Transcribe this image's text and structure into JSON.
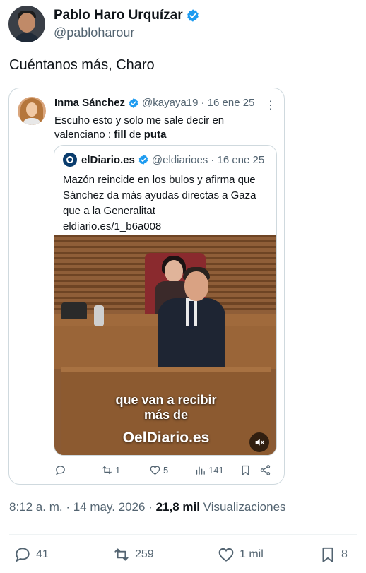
{
  "author": {
    "display_name": "Pablo Haro Urquízar",
    "handle": "@pabloharour"
  },
  "tweet_text": "Cuéntanos más, Charo",
  "quoted": {
    "display_name": "Inma Sánchez",
    "handle": "@kayaya19",
    "date": "· 16 ene 25",
    "text_prefix": "Escuho esto y solo me sale decir en valenciano : ",
    "text_bold1": "fill",
    "text_mid": " de ",
    "text_bold2": "puta",
    "inner": {
      "display_name": "elDiario.es",
      "handle": "@eldiarioes",
      "date": "· 16 ene 25",
      "text": "Mazón reincide en los bulos y afirma que Sánchez da más ayudas directas a Gaza que a la Generalitat",
      "link": "eldiario.es/1_b6a008",
      "video_caption_line1": "que van a recibir",
      "video_caption_line2": "más de",
      "video_brand": "OelDiario.es"
    },
    "actions": {
      "replies": "",
      "retweets": "1",
      "likes": "5",
      "views": "141"
    }
  },
  "timestamp": {
    "time": "8:12 a. m. · 14 may. 2026 · ",
    "views_count": "21,8 mil",
    "views_label": " Visualizaciones"
  },
  "actions": {
    "replies": "41",
    "retweets": "259",
    "likes": "1 mil",
    "bookmarks": "8"
  },
  "colors": {
    "verified": "#1d9bf0",
    "muted": "#536471",
    "text": "#0f1419",
    "border": "#cfd9de"
  }
}
